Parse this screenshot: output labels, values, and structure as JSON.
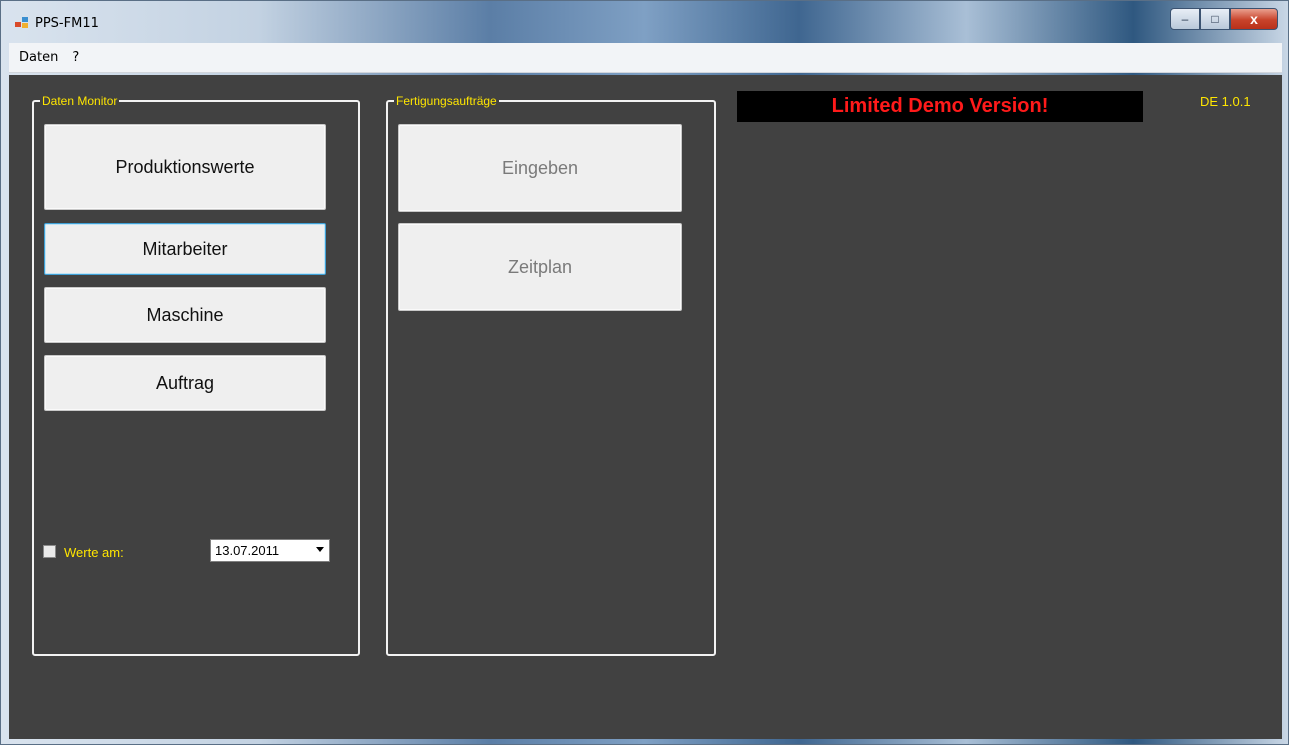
{
  "window": {
    "title": "PPS-FM11",
    "controls": {
      "minimize": "–",
      "maximize": "□",
      "close": "x"
    }
  },
  "menu": {
    "items": [
      "Daten",
      "?"
    ]
  },
  "daten_monitor": {
    "label": "Daten Monitor",
    "buttons": [
      "Produktionswerte",
      "Mitarbeiter",
      "Maschine",
      "Auftrag"
    ],
    "werte_checkbox": {
      "label": "Werte am:",
      "checked": false
    },
    "date_value": "13.07.2011"
  },
  "fertigungsauftraege": {
    "label": "Fertigungsaufträge",
    "buttons": [
      "Eingeben",
      "Zeitplan"
    ]
  },
  "demo_banner": "Limited Demo Version!",
  "version": "DE 1.0.1",
  "colors": {
    "client_bg": "#414141",
    "label_yellow": "#ffe600",
    "banner_red": "#ff1a1a"
  }
}
